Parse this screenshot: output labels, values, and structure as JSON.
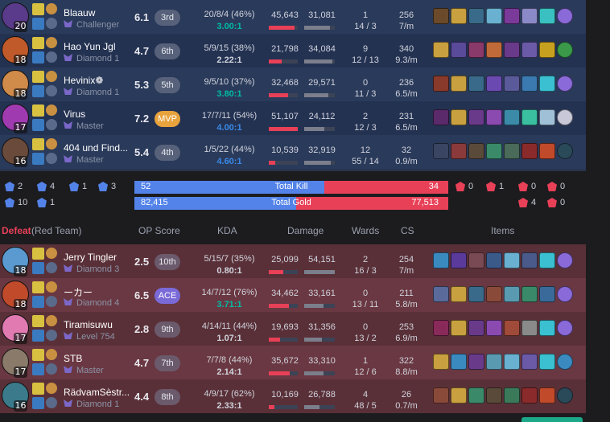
{
  "blue_team": {
    "players": [
      {
        "name": "Blaauw",
        "tier": "Challenger",
        "level": "20",
        "score": "6.1",
        "rank": "3rd",
        "rank_kind": "normal",
        "kda": "20/8/4 (46%)",
        "ratio": "3.00:1",
        "ratio_color": "#00bba3",
        "dmg_dealt": "45,643",
        "dmg_taken": "31,081",
        "dealt_frac": 0.9,
        "taken_frac": 0.85,
        "wards": "1",
        "wards2": "14 / 3",
        "cs": "256",
        "cspm": "7/m",
        "champ_color": "#5a3a8a",
        "items": [
          "#6a4a2a",
          "#c8a040",
          "#3a6a8a",
          "#6ab0d0",
          "#7a3a9a",
          "#8a8ac8",
          "#3ac0c0",
          "#8a6ad8"
        ]
      },
      {
        "name": "Hao Yun Jgl",
        "tier": "Diamond 1",
        "level": "18",
        "score": "4.7",
        "rank": "6th",
        "rank_kind": "normal",
        "kda": "5/9/15 (38%)",
        "ratio": "2.22:1",
        "ratio_color": "#d0d3dc",
        "dmg_dealt": "21,798",
        "dmg_taken": "34,084",
        "dealt_frac": 0.45,
        "taken_frac": 0.92,
        "wards": "9",
        "wards2": "12 / 13",
        "cs": "340",
        "cspm": "9.3/m",
        "champ_color": "#c05a2a",
        "items": [
          "#c8a040",
          "#5a4a9a",
          "#8a3a6a",
          "#c06a3a",
          "#6a3a8a",
          "#6a5aa8",
          "#c8a020",
          "#3a9a4a"
        ]
      },
      {
        "name": "Hevinix❁",
        "tier": "Diamond 1",
        "level": "18",
        "score": "5.3",
        "rank": "5th",
        "rank_kind": "normal",
        "kda": "9/5/10 (37%)",
        "ratio": "3.80:1",
        "ratio_color": "#00bba3",
        "dmg_dealt": "32,468",
        "dmg_taken": "29,571",
        "dealt_frac": 0.68,
        "taken_frac": 0.8,
        "wards": "0",
        "wards2": "11 / 3",
        "cs": "236",
        "cspm": "6.5/m",
        "champ_color": "#d08a4a",
        "items": [
          "#8a3a2a",
          "#c8a040",
          "#3a6a8a",
          "#6a4ab0",
          "#5a5a9a",
          "#3a7ab0",
          "#3ac0d0",
          "#8a6ad8"
        ]
      },
      {
        "name": "Virus",
        "tier": "Master",
        "level": "17",
        "score": "7.2",
        "rank": "MVP",
        "rank_kind": "mvp",
        "kda": "17/7/11 (54%)",
        "ratio": "4.00:1",
        "ratio_color": "#3a8ae8",
        "dmg_dealt": "51,107",
        "dmg_taken": "24,112",
        "dealt_frac": 1.0,
        "taken_frac": 0.65,
        "wards": "2",
        "wards2": "12 / 3",
        "cs": "231",
        "cspm": "6.5/m",
        "champ_color": "#a03ab0",
        "items": [
          "#5a2a6a",
          "#c8a040",
          "#6a3a8a",
          "#8a4ab0",
          "#3a8aa8",
          "#3ac0a0",
          "#a0c0d8",
          "#c8c8d8"
        ]
      },
      {
        "name": "404 und Find...",
        "tier": "Master",
        "level": "16",
        "score": "5.4",
        "rank": "4th",
        "rank_kind": "normal",
        "kda": "1/5/22 (44%)",
        "ratio": "4.60:1",
        "ratio_color": "#3a8ae8",
        "dmg_dealt": "10,539",
        "dmg_taken": "32,919",
        "dealt_frac": 0.22,
        "taken_frac": 0.88,
        "wards": "12",
        "wards2": "55 / 14",
        "cs": "32",
        "cspm": "0.9/m",
        "champ_color": "#6a4a3a",
        "items": [
          "empty",
          "#8a3a3a",
          "#5a4a3a",
          "#3a8a6a",
          "#4a6a5a",
          "#8a2a2a",
          "#c04a2a",
          "#2a4a5a"
        ]
      }
    ]
  },
  "summary": {
    "blue_obj": [
      {
        "v": "2"
      },
      {
        "v": "4"
      },
      {
        "v": "1"
      },
      {
        "v": "3"
      },
      {
        "v": "10"
      },
      {
        "v": "1"
      }
    ],
    "red_obj": [
      {
        "v": "0"
      },
      {
        "v": "1"
      },
      {
        "v": "0"
      },
      {
        "v": "0"
      },
      {
        "v": "4"
      },
      {
        "v": "0"
      }
    ],
    "kill_label": "Total Kill",
    "kill_blue": "52",
    "kill_red": "34",
    "kill_frac": 0.605,
    "gold_label": "Total Gold",
    "gold_blue": "82,415",
    "gold_red": "77,513",
    "gold_frac": 0.515
  },
  "header": {
    "result": "Defeat",
    "team": "(Red Team)",
    "op_score": "OP Score",
    "kda": "KDA",
    "damage": "Damage",
    "wards": "Wards",
    "cs": "CS",
    "items": "Items"
  },
  "red_team": {
    "players": [
      {
        "name": "Jerry Tingler",
        "tier": "Diamond 3",
        "level": "18",
        "score": "2.5",
        "rank": "10th",
        "rank_kind": "normal",
        "kda": "5/15/7 (35%)",
        "ratio": "0.80:1",
        "ratio_color": "#d0d3dc",
        "dmg_dealt": "25,099",
        "dmg_taken": "54,151",
        "dealt_frac": 0.5,
        "taken_frac": 1.0,
        "wards": "2",
        "wards2": "16 / 3",
        "cs": "254",
        "cspm": "7/m",
        "champ_color": "#5a9ad0",
        "items": [
          "#3a8ac0",
          "#5a3a9a",
          "empty",
          "#3a5a8a",
          "#6ab0d0",
          "#4a5a8a",
          "#3ac0d0",
          "#8a6ad8"
        ]
      },
      {
        "name": "ーカー",
        "tier": "Diamond 4",
        "level": "18",
        "score": "6.5",
        "rank": "ACE",
        "rank_kind": "ace",
        "kda": "14/7/12 (76%)",
        "ratio": "3.71:1",
        "ratio_color": "#00bba3",
        "dmg_dealt": "34,462",
        "dmg_taken": "33,161",
        "dealt_frac": 0.7,
        "taken_frac": 0.62,
        "wards": "0",
        "wards2": "13 / 11",
        "cs": "211",
        "cspm": "5.8/m",
        "champ_color": "#c04a2a",
        "items": [
          "#5a6a9a",
          "#c8a040",
          "#3a6a8a",
          "#8a4a3a",
          "#5a9ab0",
          "#3a8a6a",
          "#3a6a9a",
          "#8a6ad8"
        ]
      },
      {
        "name": "Tiramisuwu",
        "tier": "Level 754",
        "level": "17",
        "score": "2.8",
        "rank": "9th",
        "rank_kind": "normal",
        "kda": "4/14/11 (44%)",
        "ratio": "1.07:1",
        "ratio_color": "#d0d3dc",
        "dmg_dealt": "19,693",
        "dmg_taken": "31,356",
        "dealt_frac": 0.4,
        "taken_frac": 0.58,
        "wards": "0",
        "wards2": "13 / 2",
        "cs": "253",
        "cspm": "6.9/m",
        "champ_color": "#e07ab0",
        "items": [
          "#8a2a5a",
          "#c8a040",
          "#6a3a8a",
          "#8a4ab0",
          "#a04a3a",
          "#8a8a8a",
          "#3ac0d0",
          "#8a6ad8"
        ]
      },
      {
        "name": "STB",
        "tier": "Master",
        "level": "17",
        "score": "4.7",
        "rank": "7th",
        "rank_kind": "normal",
        "kda": "7/7/8 (44%)",
        "ratio": "2.14:1",
        "ratio_color": "#d0d3dc",
        "dmg_dealt": "35,672",
        "dmg_taken": "33,310",
        "dealt_frac": 0.72,
        "taken_frac": 0.62,
        "wards": "1",
        "wards2": "12 / 6",
        "cs": "322",
        "cspm": "8.8/m",
        "champ_color": "#8a7a6a",
        "items": [
          "#c8a040",
          "#3a8ac0",
          "#6a3a8a",
          "#5a9ab0",
          "#6ab0d0",
          "#6a5aa8",
          "#3ac0d0",
          "#3a8ac0"
        ]
      },
      {
        "name": "RädvamSèstr...",
        "tier": "Diamond 1",
        "level": "16",
        "score": "4.4",
        "rank": "8th",
        "rank_kind": "normal",
        "kda": "4/9/17 (62%)",
        "ratio": "2.33:1",
        "ratio_color": "#d0d3dc",
        "dmg_dealt": "10,169",
        "dmg_taken": "26,788",
        "dealt_frac": 0.2,
        "taken_frac": 0.5,
        "wards": "4",
        "wards2": "48 / 5",
        "cs": "26",
        "cspm": "0.7/m",
        "champ_color": "#3a7a8a",
        "items": [
          "#8a4a3a",
          "#c8a040",
          "#3a8a6a",
          "#5a4a3a",
          "#3a7a5a",
          "#8a2a2a",
          "#c04a2a",
          "#2a4a5a"
        ]
      }
    ]
  }
}
